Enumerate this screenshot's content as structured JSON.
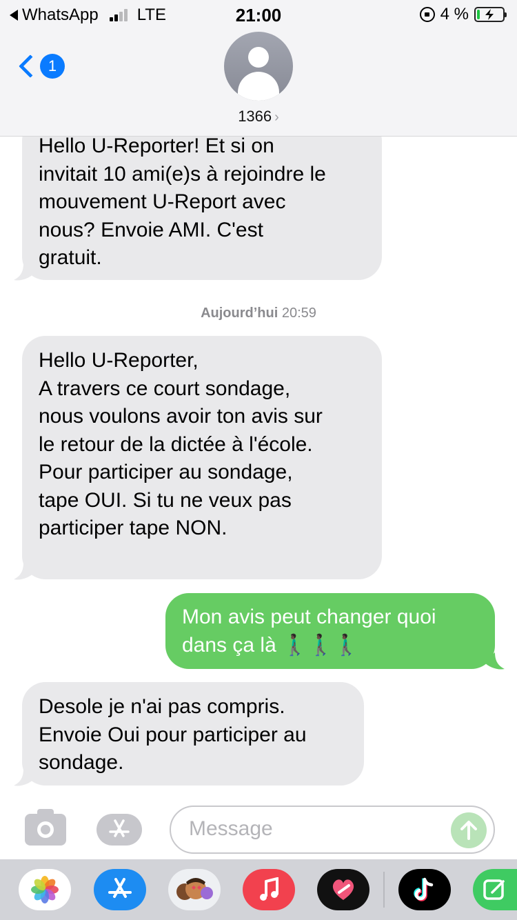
{
  "status_bar": {
    "back_app": "WhatsApp",
    "network": "LTE",
    "time": "21:00",
    "battery": "4 %"
  },
  "nav": {
    "badge_count": "1",
    "contact": "1366"
  },
  "messages": [
    {
      "direction": "incoming",
      "lines": [
        "Hello U-Reporter! Et si on",
        "invitait 10 ami(e)s à rejoindre le",
        "mouvement U-Report avec",
        "nous? Envoie AMI. C'est",
        "gratuit."
      ]
    },
    {
      "direction": "incoming",
      "lines": [
        "Hello U-Reporter,",
        "A travers ce court sondage,",
        "nous voulons avoir ton avis sur",
        "le retour de la dictée à l'école.",
        "Pour participer au sondage,",
        "tape OUI. Si tu ne veux pas",
        "participer tape NON."
      ]
    },
    {
      "direction": "outgoing",
      "lines": [
        "Mon avis peut changer quoi",
        "dans ça là 🚶🏿‍♂️🚶🏿‍♂️🚶🏿‍♂️"
      ]
    },
    {
      "direction": "incoming",
      "lines": [
        "Desole je n'ai pas compris.",
        "Envoie Oui pour participer au",
        "sondage."
      ]
    }
  ],
  "timestamp": {
    "day": "Aujourd’hui",
    "time": "20:59"
  },
  "composer": {
    "placeholder": "Message"
  },
  "app_drawer": [
    "photos-icon",
    "app-store-icon",
    "memoji-icon",
    "music-icon",
    "digital-touch-icon",
    "tiktok-icon",
    "notes-app-icon"
  ],
  "colors": {
    "accent": "#0a7bff",
    "incoming_bubble": "#e9e9eb",
    "outgoing_bubble": "#66cc63"
  }
}
